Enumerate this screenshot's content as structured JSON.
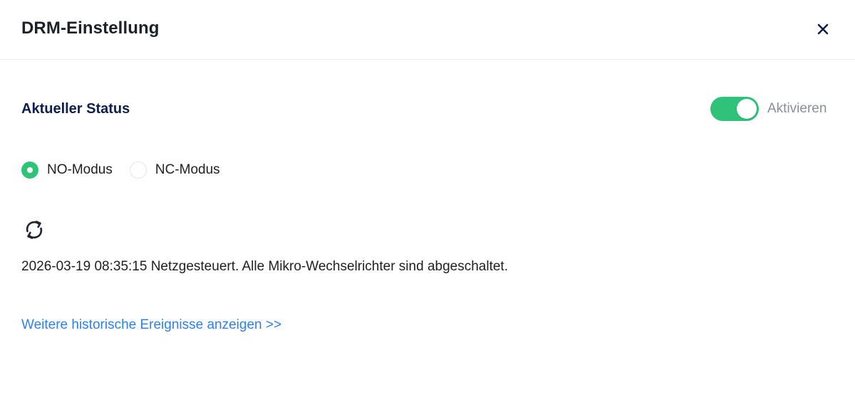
{
  "dialog": {
    "title": "DRM-Einstellung",
    "close_icon": "close-icon"
  },
  "status": {
    "section_title": "Aktueller Status",
    "toggle": {
      "label": "Aktivieren",
      "enabled": true,
      "color": "#2fc37a"
    },
    "modes": [
      {
        "label": "NO-Modus",
        "selected": true
      },
      {
        "label": "NC-Modus",
        "selected": false
      }
    ],
    "sync_icon": "refresh-icon",
    "message": "2026-03-19 08:35:15 Netzgesteuert. Alle Mikro-Wechselrichter sind abgeschaltet.",
    "history_link": "Weitere historische Ereignisse anzeigen >>"
  },
  "colors": {
    "accent": "#2fc37a",
    "link": "#2f80ed",
    "heading": "#0d1f4e"
  }
}
